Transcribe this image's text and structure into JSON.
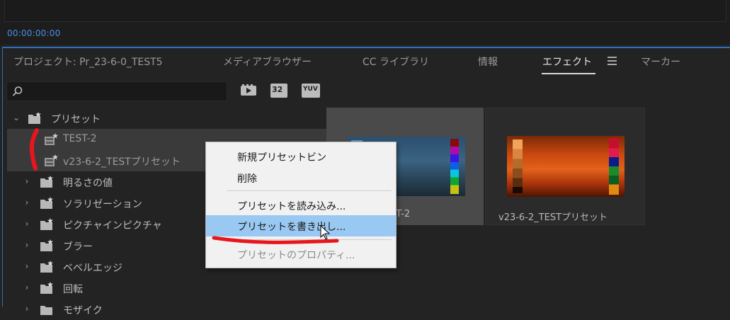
{
  "timecode": "00:00:00:00",
  "tabs": [
    {
      "label": "プロジェクト: Pr_23-6-0_TEST5",
      "active": false
    },
    {
      "label": "メディアブラウザー",
      "active": false
    },
    {
      "label": "CC ライブラリ",
      "active": false
    },
    {
      "label": "情報",
      "active": false
    },
    {
      "label": "エフェクト",
      "active": true
    },
    {
      "label": "マーカー",
      "active": false
    }
  ],
  "search": {
    "placeholder": "",
    "value": ""
  },
  "toolbar": {
    "accelerated_icon": "accelerated-effects-icon",
    "bit32_label": "32",
    "yuv_label": "YUV"
  },
  "tree": {
    "root": {
      "label": "プリセット",
      "expanded": true
    },
    "presets": [
      {
        "label": "TEST-2",
        "selected": true
      },
      {
        "label": "v23-6-2_TESTプリセット",
        "selected": true
      }
    ],
    "folders": [
      {
        "label": "明るさの値"
      },
      {
        "label": "ソラリゼーション"
      },
      {
        "label": "ピクチャインピクチャ"
      },
      {
        "label": "ブラー"
      },
      {
        "label": "ベベルエッジ"
      },
      {
        "label": "回転"
      },
      {
        "label": "モザイク"
      }
    ]
  },
  "thumbnails": [
    {
      "label": "TEST-2",
      "visible_label": "TEST-2"
    },
    {
      "label": "v23-6-2_TESTプリセット",
      "visible_label": "v23-6-2_TESTプリセット"
    }
  ],
  "context_menu": {
    "items": [
      {
        "label": "新規プリセットビン",
        "state": "normal"
      },
      {
        "label": "削除",
        "state": "normal"
      },
      {
        "label": "プリセットを読み込み...",
        "state": "normal"
      },
      {
        "label": "プリセットを書き出し...",
        "state": "highlighted"
      },
      {
        "label": "プリセットのプロパティ...",
        "state": "disabled"
      }
    ]
  },
  "colors": {
    "accent_blue": "#2f6fb8",
    "timecode_blue": "#4a8fe0",
    "menu_highlight": "#99c9f2",
    "annotation_red": "#e8161c"
  }
}
